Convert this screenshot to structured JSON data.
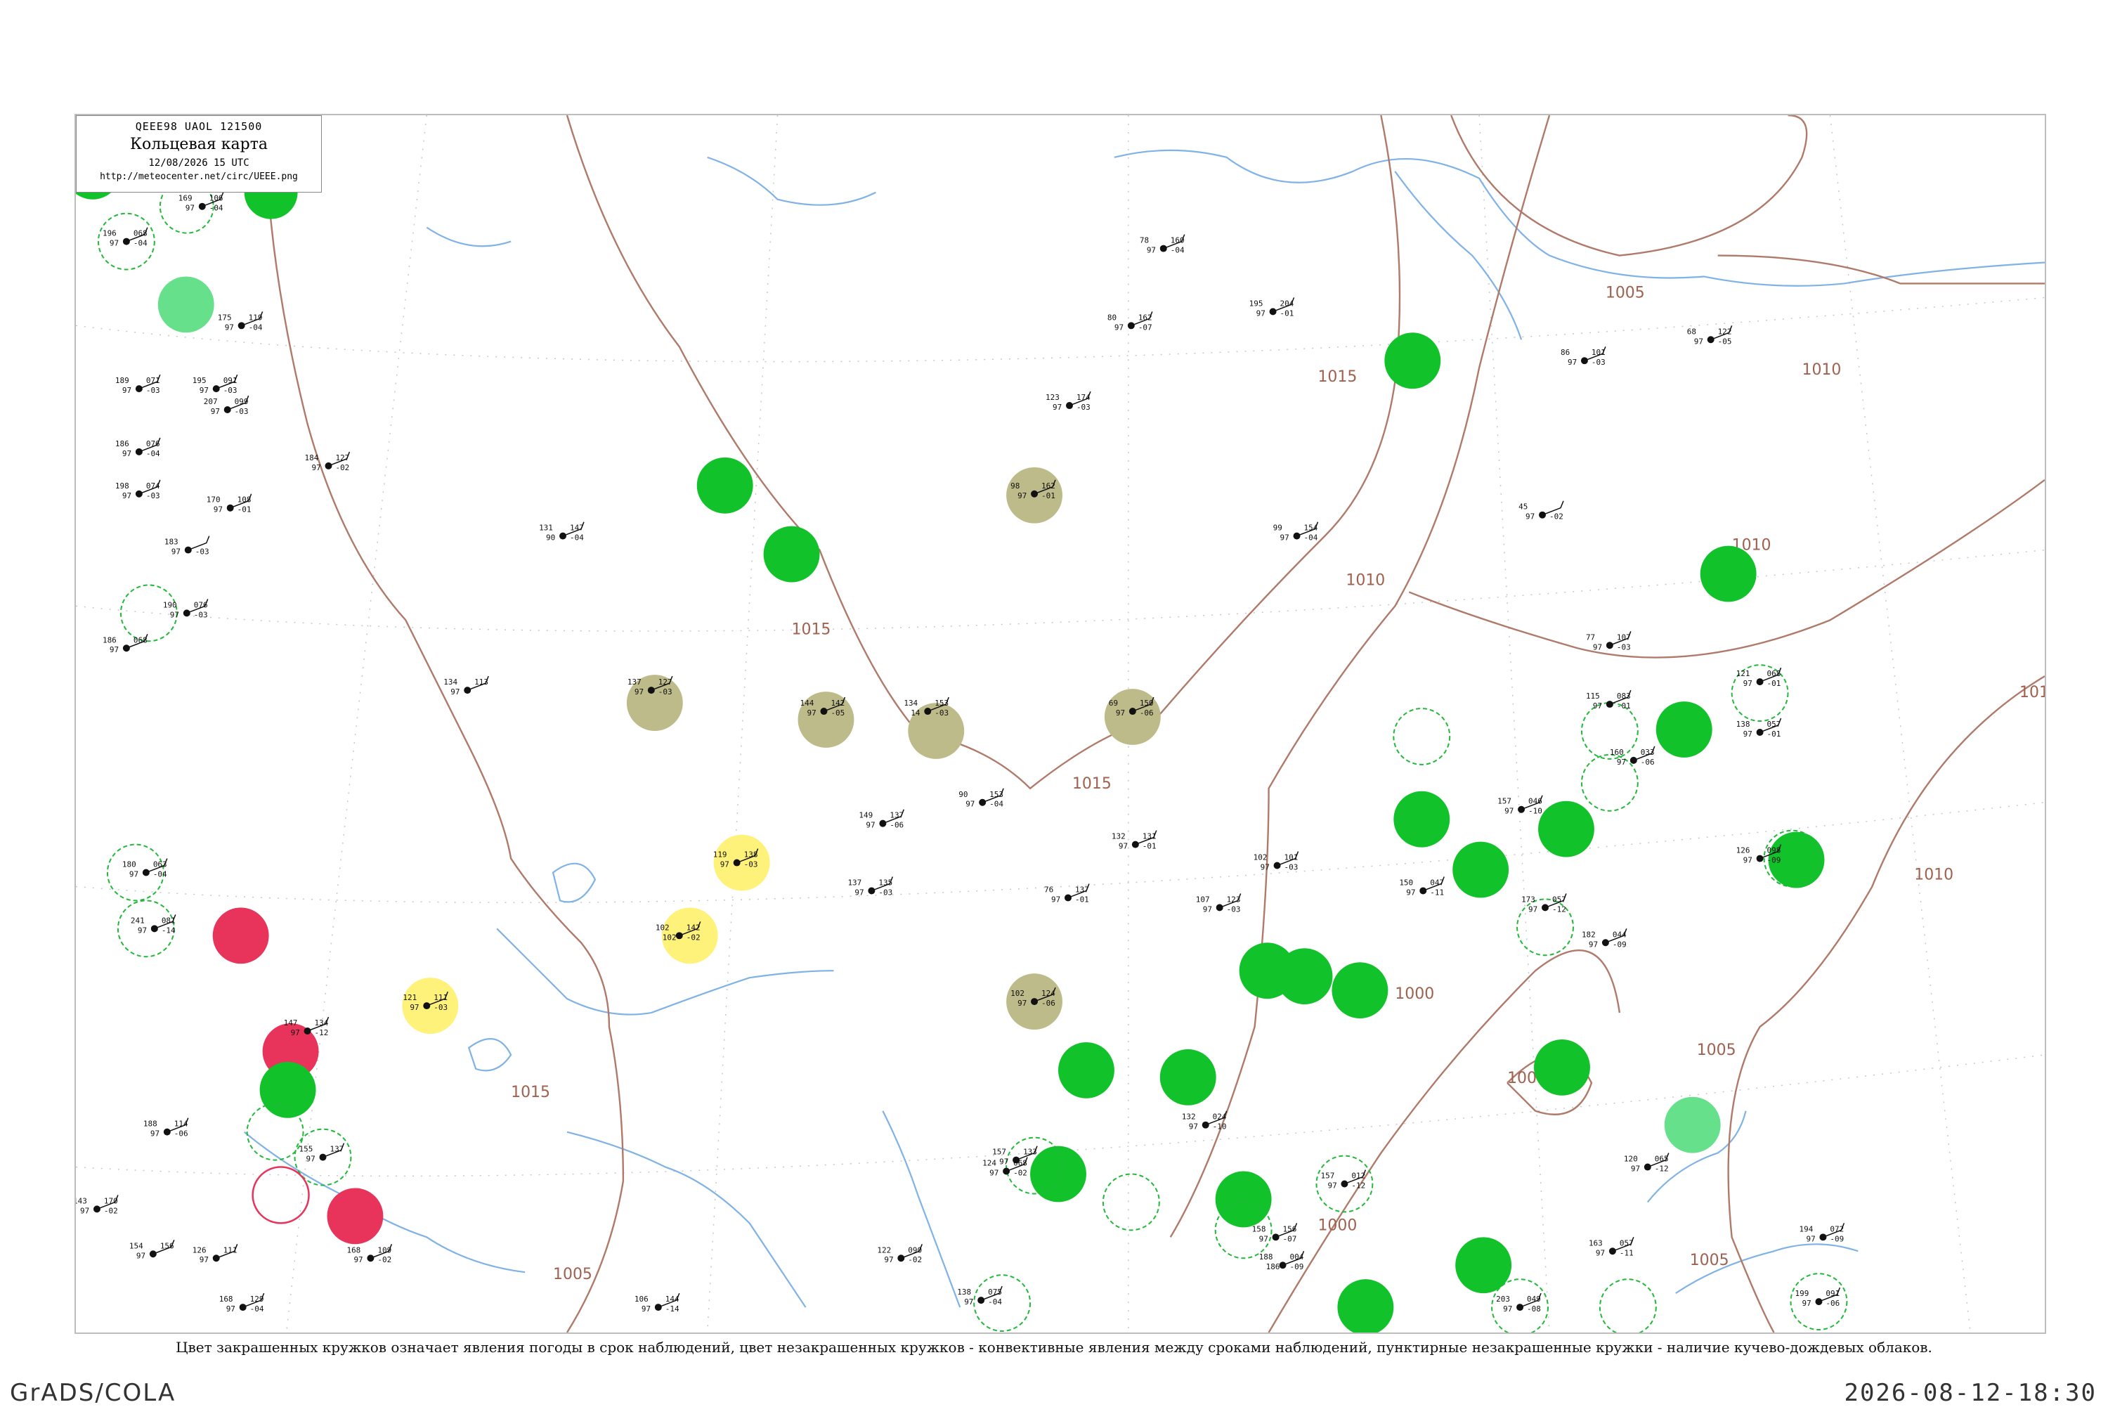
{
  "header": {
    "code": "QEEE98  UAOL  121500",
    "title": "Кольцевая карта",
    "datetime": "12/08/2026 15 UTC",
    "url": "http://meteocenter.net/circ/UEEE.png"
  },
  "caption": "Цвет закрашенных кружков означает явления погоды в срок наблюдений, цвет незакрашенных кружков - конвективные явления между сроками наблюдений, пунктирные незакрашенные кружки - наличие кучево-дождевых облаков.",
  "footer": {
    "left": "GrADS/COLA",
    "right": "2026-08-12-18:30"
  },
  "colors": {
    "isobar": "#b07a6a",
    "river": "#7fb2e6",
    "rain": "#11c22a",
    "rain_light": "#66e08a",
    "thunder": "#e8345a",
    "fog": "#bdbb8a",
    "haze": "#fff27a",
    "cb_ring": "#22b83a"
  },
  "isobars": [
    "1015",
    "1015",
    "1015",
    "1015",
    "1010",
    "1010",
    "1010",
    "1010",
    "1010",
    "1005",
    "1005",
    "1005",
    "1005",
    "1000",
    "1000",
    "1000"
  ],
  "stations": [
    {
      "id": "t1",
      "p": "196",
      "t": "068",
      "d": "-04",
      "v": "97"
    },
    {
      "id": "t2",
      "p": "189",
      "t": "071",
      "d": "-03",
      "v": "97"
    },
    {
      "id": "t3",
      "p": "195",
      "t": "091",
      "d": "-03",
      "v": "97"
    },
    {
      "id": "t4",
      "p": "186",
      "t": "076",
      "d": "-04",
      "v": "97"
    },
    {
      "id": "t5",
      "p": "198",
      "t": "074",
      "d": "-03",
      "v": "97"
    },
    {
      "id": "t6",
      "p": "183",
      "t": "",
      "d": "-03",
      "v": "97"
    },
    {
      "id": "t7",
      "p": "190",
      "t": "076",
      "d": "-03",
      "v": "97"
    },
    {
      "id": "t8",
      "p": "186",
      "t": "068",
      "d": "",
      "v": "97"
    },
    {
      "id": "t9",
      "p": "180",
      "t": "063",
      "d": "-04",
      "v": "97"
    },
    {
      "id": "t10",
      "p": "241",
      "t": "081",
      "d": "-14",
      "v": "97"
    },
    {
      "id": "t11",
      "p": "169",
      "t": "106",
      "d": "-04",
      "v": "97"
    },
    {
      "id": "t12",
      "p": "175",
      "t": "119",
      "d": "-04",
      "v": "97"
    },
    {
      "id": "t13",
      "p": "207",
      "t": "099",
      "d": "-03",
      "v": "97"
    },
    {
      "id": "t14",
      "p": "170",
      "t": "108",
      "d": "-01",
      "v": "97"
    },
    {
      "id": "t15",
      "p": "184",
      "t": "127",
      "d": "-02",
      "v": "97"
    },
    {
      "id": "t16",
      "p": "131",
      "t": "147",
      "d": "-04",
      "v": "90"
    },
    {
      "id": "t17",
      "p": "137",
      "t": "127",
      "d": "-03",
      "v": "97"
    },
    {
      "id": "t18",
      "p": "134",
      "t": "113",
      "d": "",
      "v": "97"
    },
    {
      "id": "t19",
      "p": "119",
      "t": "138",
      "d": "-03",
      "v": "97"
    },
    {
      "id": "t20",
      "p": "102",
      "t": "142",
      "d": "-02",
      "v": "102"
    },
    {
      "id": "t21",
      "p": "121",
      "t": "111",
      "d": "-03",
      "v": "97"
    },
    {
      "id": "t22",
      "p": "134",
      "t": "153",
      "d": "-03",
      "v": "14"
    },
    {
      "id": "t23",
      "p": "144",
      "t": "142",
      "d": "-05",
      "v": "97"
    },
    {
      "id": "t24",
      "p": "98",
      "t": "162",
      "d": "-01",
      "v": "97"
    },
    {
      "id": "t25",
      "p": "69",
      "t": "150",
      "d": "-06",
      "v": "97"
    },
    {
      "id": "t26",
      "p": "102",
      "t": "124",
      "d": "-06",
      "v": "97"
    },
    {
      "id": "t27",
      "p": "123",
      "t": "174",
      "d": "-03",
      "v": "97"
    },
    {
      "id": "t28",
      "p": "80",
      "t": "162",
      "d": "-07",
      "v": "97"
    },
    {
      "id": "t29",
      "p": "78",
      "t": "160",
      "d": "-04",
      "v": "97"
    },
    {
      "id": "t30",
      "p": "195",
      "t": "204",
      "d": "-01",
      "v": "97"
    },
    {
      "id": "t31",
      "p": "99",
      "t": "154",
      "d": "-04",
      "v": "97"
    },
    {
      "id": "t32",
      "p": "45",
      "t": "",
      "d": "-02",
      "v": "97"
    },
    {
      "id": "t33",
      "p": "86",
      "t": "101",
      "d": "-03",
      "v": "97"
    },
    {
      "id": "t34",
      "p": "68",
      "t": "122",
      "d": "-05",
      "v": "97"
    },
    {
      "id": "t35",
      "p": "77",
      "t": "107",
      "d": "-03",
      "v": "97"
    },
    {
      "id": "t36",
      "p": "115",
      "t": "083",
      "d": "-01",
      "v": "97"
    },
    {
      "id": "t37",
      "p": "121",
      "t": "068",
      "d": "-01",
      "v": "97"
    },
    {
      "id": "t38",
      "p": "138",
      "t": "057",
      "d": "-01",
      "v": "97"
    },
    {
      "id": "t39",
      "p": "126",
      "t": "098",
      "d": "-09",
      "v": "97"
    },
    {
      "id": "t40",
      "p": "157",
      "t": "046",
      "d": "-10",
      "v": "97"
    },
    {
      "id": "t41",
      "p": "150",
      "t": "047",
      "d": "-11",
      "v": "97"
    },
    {
      "id": "t42",
      "p": "173",
      "t": "057",
      "d": "-12",
      "v": "97"
    },
    {
      "id": "t43",
      "p": "182",
      "t": "044",
      "d": "-09",
      "v": "97"
    },
    {
      "id": "t44",
      "p": "160",
      "t": "033",
      "d": "-06",
      "v": "97"
    },
    {
      "id": "t45",
      "p": "132",
      "t": "131",
      "d": "-01",
      "v": "97"
    },
    {
      "id": "t46",
      "p": "107",
      "t": "123",
      "d": "-03",
      "v": "97"
    },
    {
      "id": "t47",
      "p": "102",
      "t": "101",
      "d": "-03",
      "v": "97"
    },
    {
      "id": "t48",
      "p": "149",
      "t": "137",
      "d": "-06",
      "v": "97"
    },
    {
      "id": "t49",
      "p": "137",
      "t": "135",
      "d": "-03",
      "v": "97"
    },
    {
      "id": "t50",
      "p": "90",
      "t": "153",
      "d": "-04",
      "v": "97"
    },
    {
      "id": "t51",
      "p": "76",
      "t": "137",
      "d": "-01",
      "v": "97"
    },
    {
      "id": "t52",
      "p": "132",
      "t": "024",
      "d": "-10",
      "v": "97"
    },
    {
      "id": "t53",
      "p": "157",
      "t": "012",
      "d": "-12",
      "v": "97"
    },
    {
      "id": "t54",
      "p": "188",
      "t": "004",
      "d": "-09",
      "v": "186"
    },
    {
      "id": "t55",
      "p": "120",
      "t": "065",
      "d": "-12",
      "v": "97"
    },
    {
      "id": "t56",
      "p": "163",
      "t": "057",
      "d": "-11",
      "v": "97"
    },
    {
      "id": "t57",
      "p": "194",
      "t": "072",
      "d": "-09",
      "v": "97"
    },
    {
      "id": "t58",
      "p": "199",
      "t": "091",
      "d": "-06",
      "v": "97"
    },
    {
      "id": "t59",
      "p": "188",
      "t": "114",
      "d": "-06",
      "v": "97"
    },
    {
      "id": "t60",
      "p": "143",
      "t": "170",
      "d": "-02",
      "v": "97"
    },
    {
      "id": "t61",
      "p": "154",
      "t": "156",
      "d": "",
      "v": "97"
    },
    {
      "id": "t62",
      "p": "168",
      "t": "129",
      "d": "-04",
      "v": "97"
    },
    {
      "id": "t63",
      "p": "126",
      "t": "111",
      "d": "",
      "v": "97"
    },
    {
      "id": "t64",
      "p": "147",
      "t": "134",
      "d": "-12",
      "v": "97"
    },
    {
      "id": "t65",
      "p": "155",
      "t": "137",
      "d": "",
      "v": "97"
    },
    {
      "id": "t66",
      "p": "106",
      "t": "144",
      "d": "-14",
      "v": "97"
    },
    {
      "id": "t67",
      "p": "157",
      "t": "133",
      "d": "",
      "v": "97"
    },
    {
      "id": "t68",
      "p": "138",
      "t": "075",
      "d": "-04",
      "v": "97"
    },
    {
      "id": "t69",
      "p": "124",
      "t": "068",
      "d": "-02",
      "v": "97"
    },
    {
      "id": "t70",
      "p": "122",
      "t": "090",
      "d": "-02",
      "v": "97"
    },
    {
      "id": "t71",
      "p": "203",
      "t": "049",
      "d": "-08",
      "v": "97"
    },
    {
      "id": "t72",
      "p": "158",
      "t": "156",
      "d": "-07",
      "v": "97"
    },
    {
      "id": "t73",
      "p": "168",
      "t": "109",
      "d": "-02",
      "v": "97"
    }
  ]
}
